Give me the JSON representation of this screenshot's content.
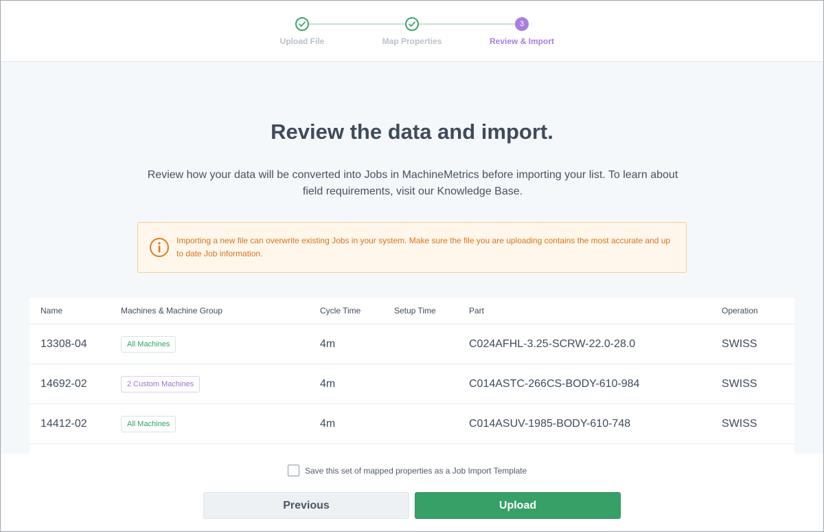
{
  "stepper": {
    "steps": [
      {
        "label": "Upload File",
        "status": "done"
      },
      {
        "label": "Map Properties",
        "status": "done"
      },
      {
        "label": "Review & Import",
        "status": "current",
        "number": "3"
      }
    ]
  },
  "main": {
    "title": "Review the data and import.",
    "description": "Review how your data will be converted into Jobs in MachineMetrics before importing your list. To learn about field requirements, visit our Knowledge Base.",
    "warning": "Importing a new file can overwrite existing Jobs in your system. Make sure the file you are uploading contains the most accurate and up to date Job information."
  },
  "table": {
    "headers": {
      "name": "Name",
      "machines": "Machines & Machine Group",
      "cycle_time": "Cycle Time",
      "setup_time": "Setup Time",
      "part": "Part",
      "operation": "Operation"
    },
    "rows": [
      {
        "name": "13308-04",
        "machines": "All Machines",
        "cycle_time": "4m",
        "setup_time": "",
        "part": "C024AFHL-3.25-SCRW-22.0-28.0",
        "operation": "SWISS"
      },
      {
        "name": "14692-02",
        "machines": "2 Custom Machines",
        "cycle_time": "4m",
        "setup_time": "",
        "part": "C014ASTC-266CS-BODY-610-984",
        "operation": "SWISS"
      },
      {
        "name": "14412-02",
        "machines": "All Machines",
        "cycle_time": "4m",
        "setup_time": "",
        "part": "C014ASUV-1985-BODY-610-748",
        "operation": "SWISS"
      }
    ]
  },
  "footer": {
    "save_template_label": "Save this set of mapped properties as a Job Import Template",
    "save_template_checked": false,
    "previous_label": "Previous",
    "upload_label": "Upload"
  },
  "colors": {
    "accent_green": "#37a066",
    "accent_purple": "#a77fe0",
    "warning_orange": "#d9731b",
    "warning_bg": "#fff7ec"
  }
}
